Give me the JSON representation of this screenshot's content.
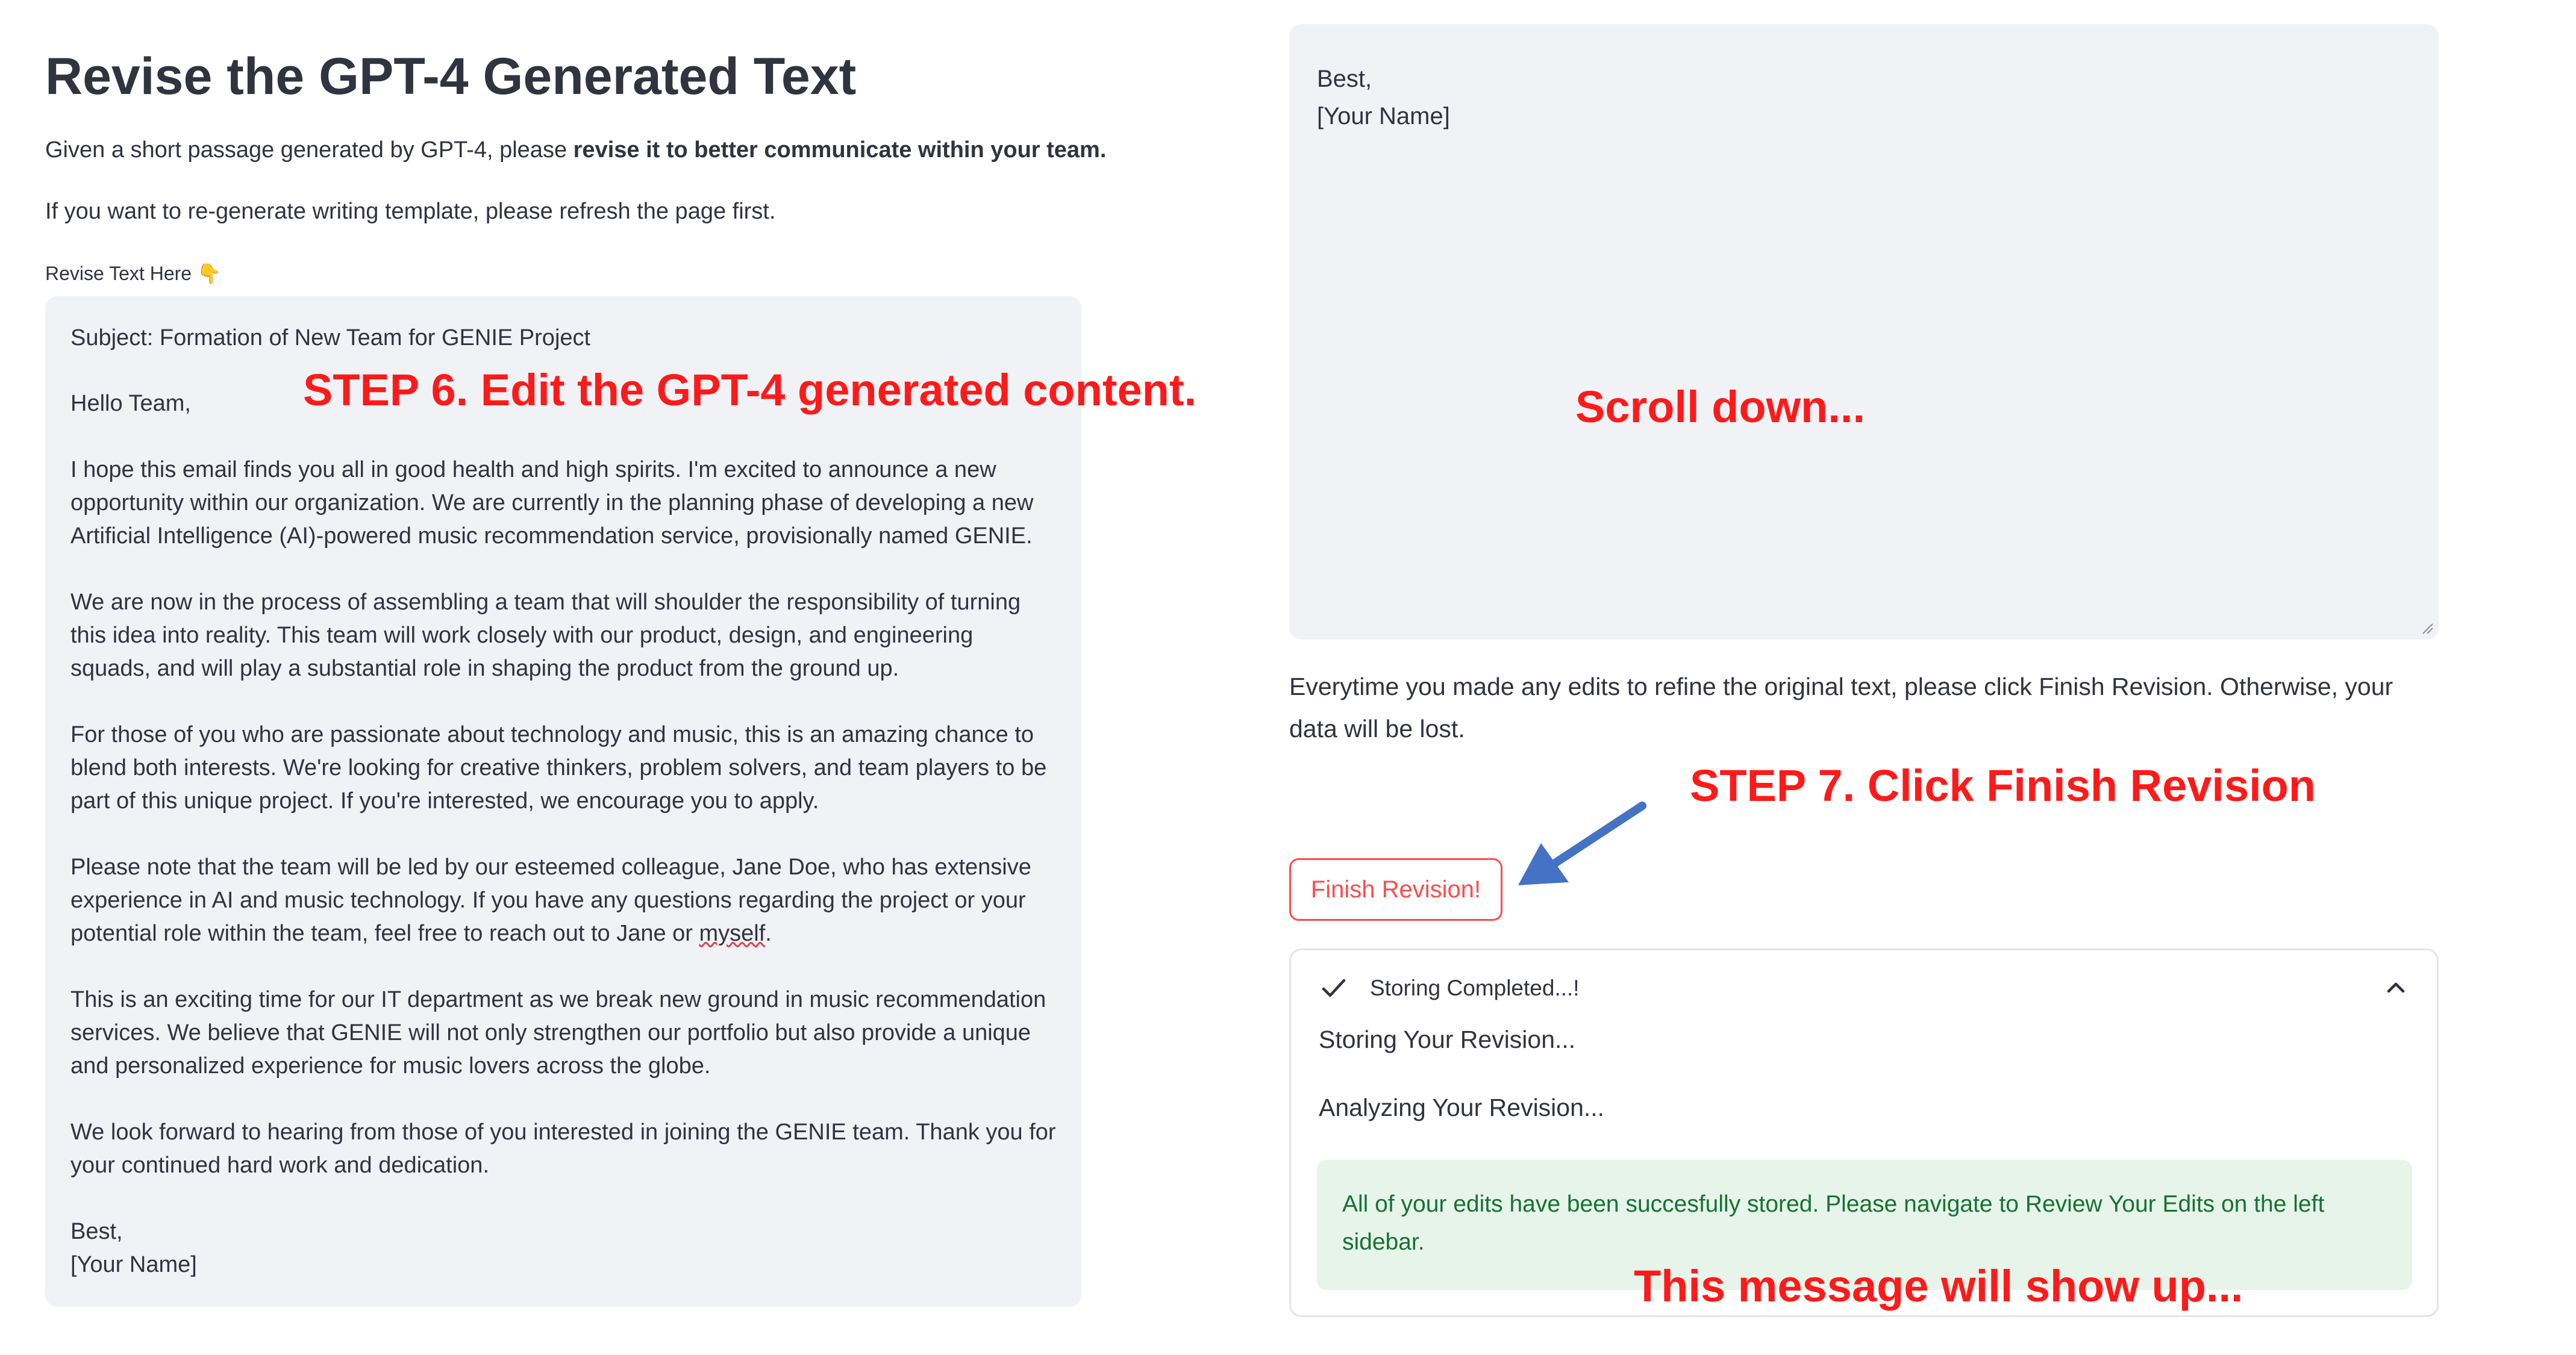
{
  "page": {
    "title": "Revise the GPT-4 Generated Text",
    "intro_prefix": "Given a short passage generated by GPT-4, please ",
    "intro_bold": "revise it to better communicate within your team.",
    "refresh_note": "If you want to re-generate writing template, please refresh the page first.",
    "textarea_label": "Revise Text Here 👇"
  },
  "left_textarea": {
    "paragraphs": [
      "Subject: Formation of New Team for GENIE Project",
      "Hello Team,",
      "I hope this email finds you all in good health and high spirits. I'm excited to announce a new opportunity within our organization. We are currently in the planning phase of developing a new Artificial Intelligence (AI)-powered music recommendation service, provisionally named GENIE.",
      "We are now in the process of assembling a team that will shoulder the responsibility of turning this idea into reality. This team will work closely with our product, design, and engineering squads, and will play a substantial role in shaping the product from the ground up.",
      "For those of you who are passionate about technology and music, this is an amazing chance to blend both interests. We're looking for creative thinkers, problem solvers, and team players to be part of this unique project. If you're interested, we encourage you to apply.",
      "Please note that the team will be led by our esteemed colleague, Jane Doe, who has extensive experience in AI and music technology. If you have any questions regarding the project or your potential role within the team, feel free to reach out to Jane or ",
      "This is an exciting time for our IT department as we break new ground in music recommendation services. We believe that GENIE will not only strengthen our portfolio but also provide a unique and personalized experience for music lovers across the globe.",
      "We look forward to hearing from those of you interested in joining the GENIE team. Thank you for your continued hard work and dedication."
    ],
    "misspelled_word": "myself",
    "misspelled_suffix": ".",
    "closing": "Best,",
    "signature": "[Your Name]"
  },
  "right_textarea": {
    "closing": "Best,",
    "signature": "[Your Name]"
  },
  "warning_text": "Everytime you made any edits to refine the original text, please click Finish Revision. Otherwise, your data will be lost.",
  "finish_button_label": "Finish Revision!",
  "status": {
    "title": "Storing Completed...!",
    "step_storing": "Storing Your Revision...",
    "step_analyzing": "Analyzing Your Revision...",
    "success_message": "All of your edits have been succesfully stored. Please navigate to Review Your Edits on the left sidebar.",
    "icons": [
      "check-icon",
      "chevron-up-icon"
    ]
  },
  "annotations": {
    "step6": "STEP 6. Edit the GPT-4 generated content.",
    "scroll": "Scroll down...",
    "step7": "STEP 7. Click Finish Revision",
    "message": "This message will show up..."
  },
  "colors": {
    "accent": "#ff4b4b",
    "annotation": "#ff1a1a",
    "arrow": "#4472c4",
    "success_bg": "#e6f4ea",
    "success_text": "#177233",
    "textarea_bg": "#f0f2f6"
  }
}
